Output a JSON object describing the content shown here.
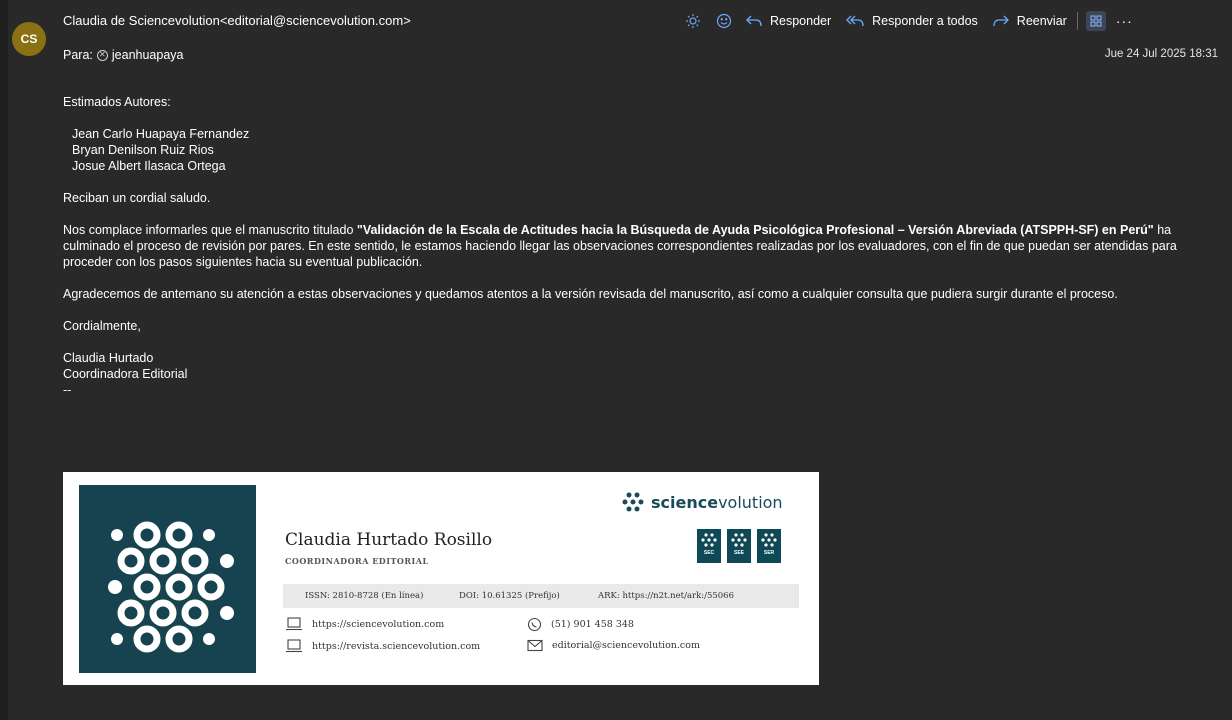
{
  "email": {
    "avatar_initials": "CS",
    "avatar_color": "#8a7214",
    "from": "Claudia de Sciencevolution<editorial@sciencevolution.com>",
    "to_label": "Para:",
    "to_recipient": "jeanhuapaya",
    "date": "Jue 24 Jul 2025 18:31"
  },
  "toolbar": {
    "reply": "Responder",
    "reply_all": "Responder a todos",
    "forward": "Reenviar",
    "more": "···",
    "icons": [
      "sun-icon",
      "smiley-icon",
      "reply-icon",
      "reply-all-icon",
      "forward-icon",
      "apps-icon",
      "more-icon"
    ]
  },
  "body": {
    "greeting": "Estimados Autores:",
    "authors": [
      "Jean Carlo Huapaya Fernandez",
      "Bryan Denilson Ruiz Rios",
      "Josue Albert Ilasaca Ortega"
    ],
    "salutation": "Reciban un cordial saludo.",
    "para1_before": "Nos complace informarles que el manuscrito titulado ",
    "para1_title": "\"Validación de la Escala de Actitudes hacia la Búsqueda de Ayuda Psicológica Profesional – Versión Abreviada (ATSPPH-SF) en Perú\"",
    "para1_after": " ha culminado el proceso de revisión por pares. En este sentido, le estamos haciendo llegar las observaciones correspondientes realizadas por los evaluadores, con el fin de que puedan ser atendidas para proceder con los pasos siguientes hacia su eventual publicación.",
    "para2": "Agradecemos de antemano su atención a estas observaciones y quedamos atentos a la versión revisada del manuscrito, así como a cualquier consulta que pudiera surgir durante el proceso.",
    "closing": "Cordialmente,",
    "sender_name": "Claudia Hurtado",
    "sender_role": "Coordinadora Editorial",
    "sig_sep": "--"
  },
  "signature": {
    "name": "Claudia Hurtado Rosillo",
    "role": "COORDINADORA EDITORIAL",
    "brand_bold": "science",
    "brand_light": "volution",
    "badges": [
      "SEC",
      "SEE",
      "SER"
    ],
    "issn": "ISSN: 2810-8728 (En línea)",
    "doi": "DOI: 10.61325 (Prefijo)",
    "ark": "ARK: https://n2t.net/ark:/55066",
    "website": "https://sciencevolution.com",
    "journal_site": "https://revista.sciencevolution.com",
    "phone": "(51) 901 458 348",
    "email": "editorial@sciencevolution.com",
    "brand_color": "#16434f"
  }
}
